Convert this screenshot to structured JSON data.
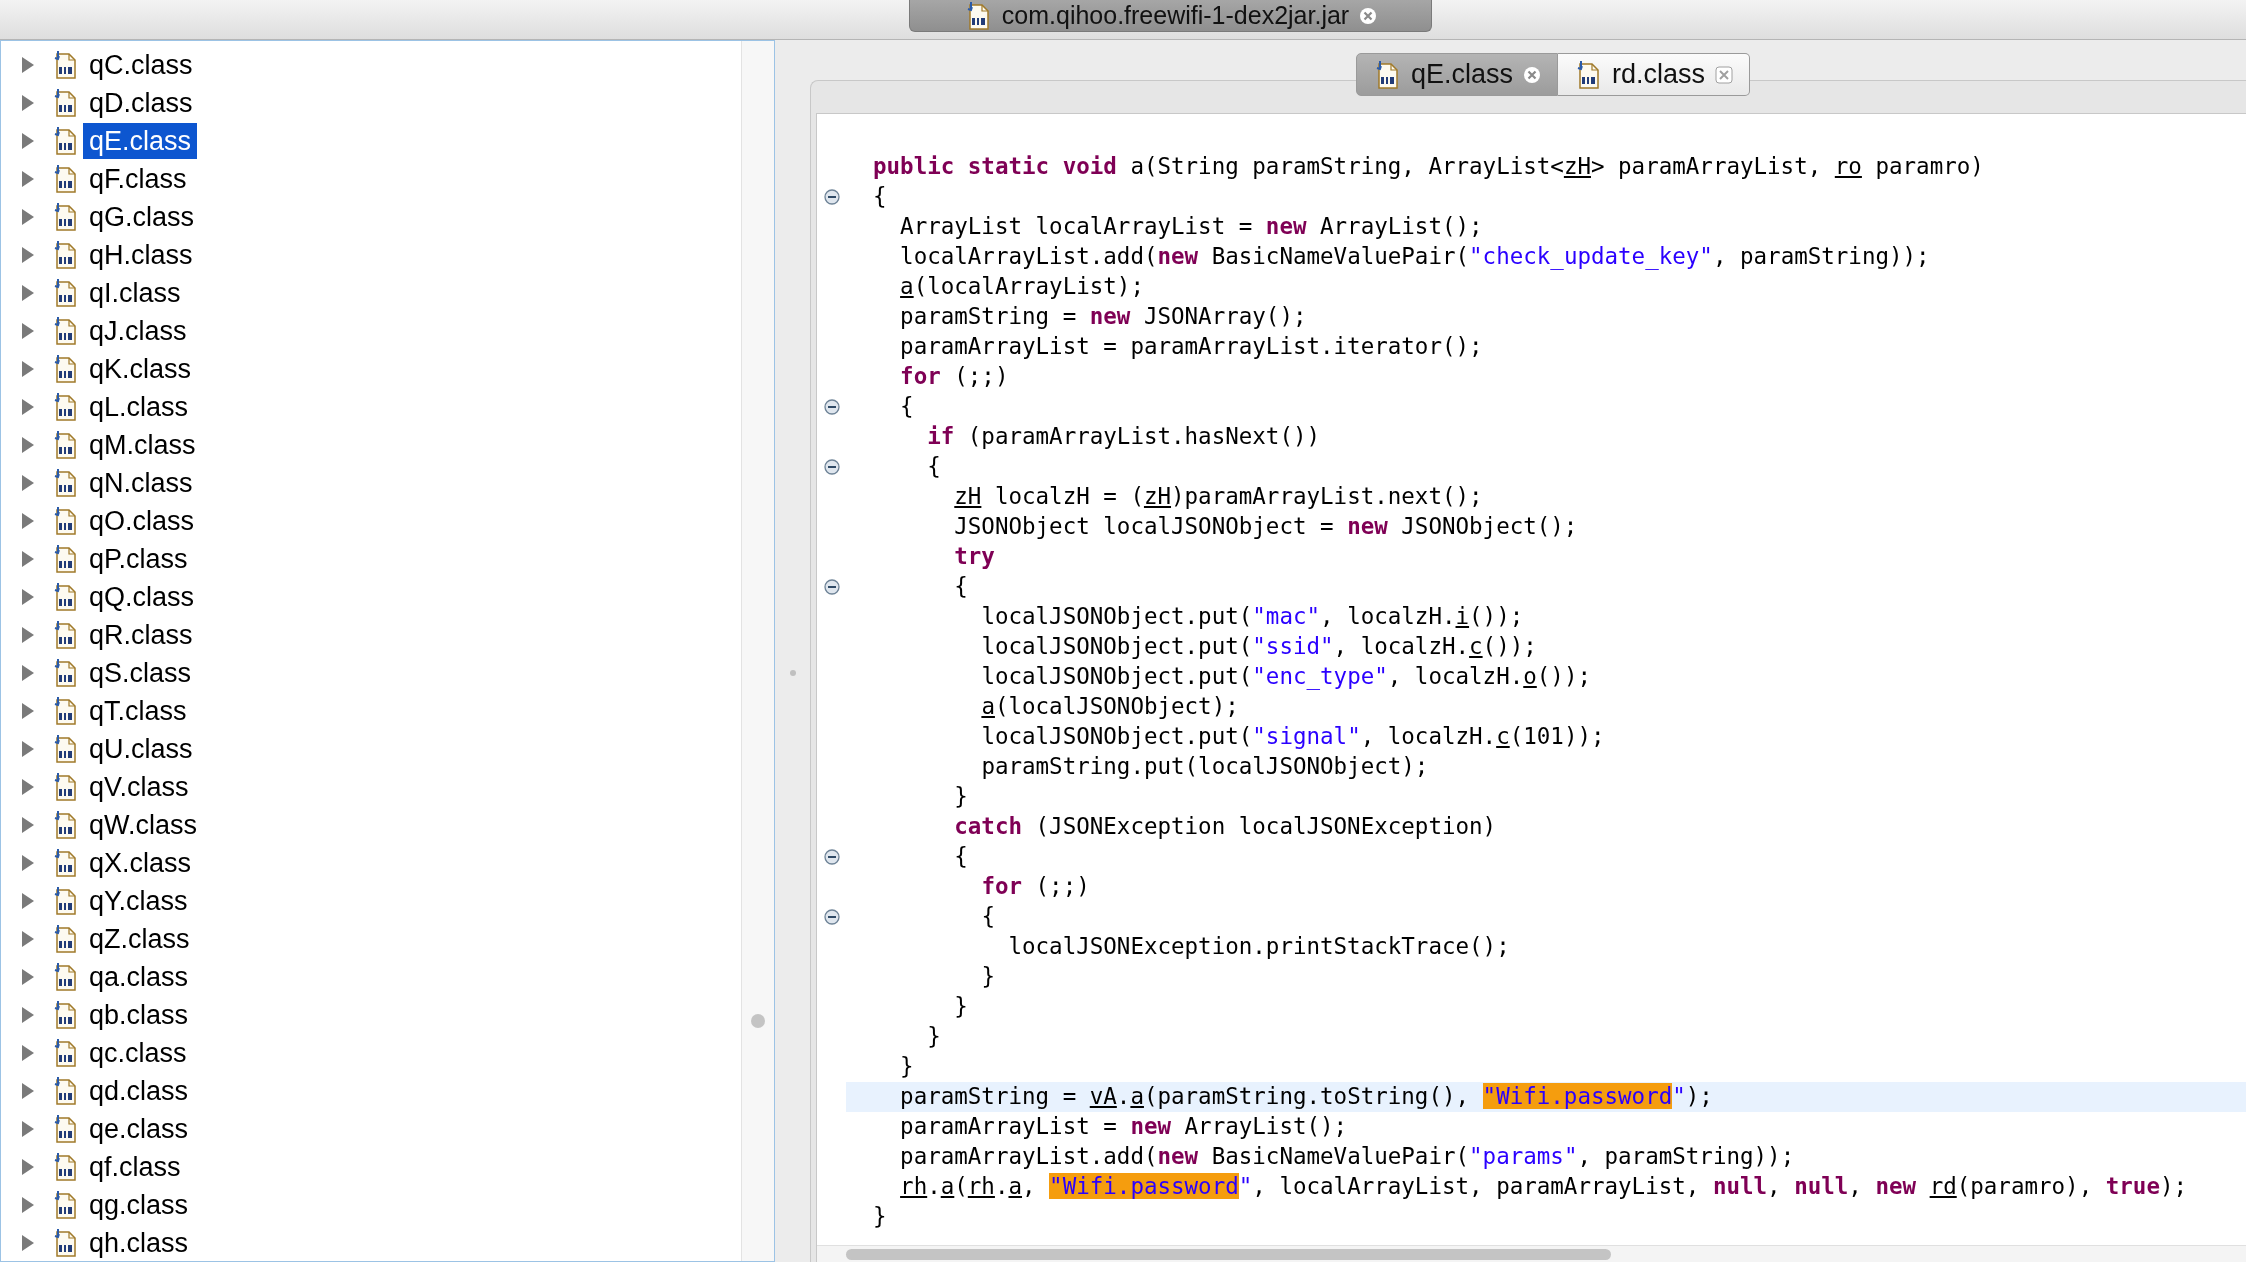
{
  "window_tab": {
    "title": "com.qihoo.freewifi-1-dex2jar.jar"
  },
  "tree": {
    "items": [
      {
        "label": "qC.class",
        "selected": false,
        "expanded": false
      },
      {
        "label": "qD.class",
        "selected": false,
        "expanded": false
      },
      {
        "label": "qE.class",
        "selected": true,
        "expanded": false
      },
      {
        "label": "qF.class",
        "selected": false,
        "expanded": false
      },
      {
        "label": "qG.class",
        "selected": false,
        "expanded": false
      },
      {
        "label": "qH.class",
        "selected": false,
        "expanded": false
      },
      {
        "label": "qI.class",
        "selected": false,
        "expanded": false
      },
      {
        "label": "qJ.class",
        "selected": false,
        "expanded": false
      },
      {
        "label": "qK.class",
        "selected": false,
        "expanded": false
      },
      {
        "label": "qL.class",
        "selected": false,
        "expanded": false
      },
      {
        "label": "qM.class",
        "selected": false,
        "expanded": false
      },
      {
        "label": "qN.class",
        "selected": false,
        "expanded": false
      },
      {
        "label": "qO.class",
        "selected": false,
        "expanded": false
      },
      {
        "label": "qP.class",
        "selected": false,
        "expanded": false
      },
      {
        "label": "qQ.class",
        "selected": false,
        "expanded": false
      },
      {
        "label": "qR.class",
        "selected": false,
        "expanded": false
      },
      {
        "label": "qS.class",
        "selected": false,
        "expanded": false
      },
      {
        "label": "qT.class",
        "selected": false,
        "expanded": false
      },
      {
        "label": "qU.class",
        "selected": false,
        "expanded": false
      },
      {
        "label": "qV.class",
        "selected": false,
        "expanded": false
      },
      {
        "label": "qW.class",
        "selected": false,
        "expanded": false
      },
      {
        "label": "qX.class",
        "selected": false,
        "expanded": false
      },
      {
        "label": "qY.class",
        "selected": false,
        "expanded": false
      },
      {
        "label": "qZ.class",
        "selected": false,
        "expanded": false
      },
      {
        "label": "qa.class",
        "selected": false,
        "expanded": false
      },
      {
        "label": "qb.class",
        "selected": false,
        "expanded": false
      },
      {
        "label": "qc.class",
        "selected": false,
        "expanded": false
      },
      {
        "label": "qd.class",
        "selected": false,
        "expanded": false
      },
      {
        "label": "qe.class",
        "selected": false,
        "expanded": false
      },
      {
        "label": "qf.class",
        "selected": false,
        "expanded": false
      },
      {
        "label": "qg.class",
        "selected": false,
        "expanded": false
      },
      {
        "label": "qh.class",
        "selected": false,
        "expanded": false
      }
    ]
  },
  "tabs": [
    {
      "label": "qE.class",
      "selected": true
    },
    {
      "label": "rd.class",
      "selected": false
    }
  ],
  "code": {
    "lines": [
      {
        "fold": false,
        "current": false,
        "tokens": [
          {
            "kind": "keyword",
            "text": "public static void"
          },
          {
            "kind": "plain",
            "text": " a(String paramString, ArrayList<"
          },
          {
            "kind": "ref",
            "text": "zH"
          },
          {
            "kind": "plain",
            "text": "> paramArrayList, "
          },
          {
            "kind": "ref",
            "text": "ro"
          },
          {
            "kind": "plain",
            "text": " paramro)"
          }
        ]
      },
      {
        "fold": true,
        "current": false,
        "tokens": [
          {
            "kind": "plain",
            "text": "{"
          }
        ]
      },
      {
        "fold": false,
        "current": false,
        "tokens": [
          {
            "kind": "plain",
            "text": "  ArrayList localArrayList = "
          },
          {
            "kind": "keyword",
            "text": "new"
          },
          {
            "kind": "plain",
            "text": " ArrayList();"
          }
        ]
      },
      {
        "fold": false,
        "current": false,
        "tokens": [
          {
            "kind": "plain",
            "text": "  localArrayList.add("
          },
          {
            "kind": "keyword",
            "text": "new"
          },
          {
            "kind": "plain",
            "text": " BasicNameValuePair("
          },
          {
            "kind": "string",
            "text": "\"check_update_key\""
          },
          {
            "kind": "plain",
            "text": ", paramString));"
          }
        ]
      },
      {
        "fold": false,
        "current": false,
        "tokens": [
          {
            "kind": "ref",
            "text": "  a"
          },
          {
            "kind": "plain",
            "text": "(localArrayList);"
          }
        ]
      },
      {
        "fold": false,
        "current": false,
        "tokens": [
          {
            "kind": "plain",
            "text": "  paramString = "
          },
          {
            "kind": "keyword",
            "text": "new"
          },
          {
            "kind": "plain",
            "text": " JSONArray();"
          }
        ]
      },
      {
        "fold": false,
        "current": false,
        "tokens": [
          {
            "kind": "plain",
            "text": "  paramArrayList = paramArrayList.iterator();"
          }
        ]
      },
      {
        "fold": false,
        "current": false,
        "tokens": [
          {
            "kind": "keyword",
            "text": "  for"
          },
          {
            "kind": "plain",
            "text": " (;;)"
          }
        ]
      },
      {
        "fold": true,
        "current": false,
        "tokens": [
          {
            "kind": "plain",
            "text": "  {"
          }
        ]
      },
      {
        "fold": false,
        "current": false,
        "tokens": [
          {
            "kind": "keyword",
            "text": "    if"
          },
          {
            "kind": "plain",
            "text": " (paramArrayList.hasNext())"
          }
        ]
      },
      {
        "fold": true,
        "current": false,
        "tokens": [
          {
            "kind": "plain",
            "text": "    {"
          }
        ]
      },
      {
        "fold": false,
        "current": false,
        "tokens": [
          {
            "kind": "ref",
            "text": "      zH"
          },
          {
            "kind": "plain",
            "text": " localzH = ("
          },
          {
            "kind": "ref",
            "text": "zH"
          },
          {
            "kind": "plain",
            "text": ")paramArrayList.next();"
          }
        ]
      },
      {
        "fold": false,
        "current": false,
        "tokens": [
          {
            "kind": "plain",
            "text": "      JSONObject localJSONObject = "
          },
          {
            "kind": "keyword",
            "text": "new"
          },
          {
            "kind": "plain",
            "text": " JSONObject();"
          }
        ]
      },
      {
        "fold": false,
        "current": false,
        "tokens": [
          {
            "kind": "keyword",
            "text": "      try"
          }
        ]
      },
      {
        "fold": true,
        "current": false,
        "tokens": [
          {
            "kind": "plain",
            "text": "      {"
          }
        ]
      },
      {
        "fold": false,
        "current": false,
        "tokens": [
          {
            "kind": "plain",
            "text": "        localJSONObject.put("
          },
          {
            "kind": "string",
            "text": "\"mac\""
          },
          {
            "kind": "plain",
            "text": ", localzH."
          },
          {
            "kind": "ref",
            "text": "i"
          },
          {
            "kind": "plain",
            "text": "());"
          }
        ]
      },
      {
        "fold": false,
        "current": false,
        "tokens": [
          {
            "kind": "plain",
            "text": "        localJSONObject.put("
          },
          {
            "kind": "string",
            "text": "\"ssid\""
          },
          {
            "kind": "plain",
            "text": ", localzH."
          },
          {
            "kind": "ref",
            "text": "c"
          },
          {
            "kind": "plain",
            "text": "());"
          }
        ]
      },
      {
        "fold": false,
        "current": false,
        "tokens": [
          {
            "kind": "plain",
            "text": "        localJSONObject.put("
          },
          {
            "kind": "string",
            "text": "\"enc_type\""
          },
          {
            "kind": "plain",
            "text": ", localzH."
          },
          {
            "kind": "ref",
            "text": "o"
          },
          {
            "kind": "plain",
            "text": "());"
          }
        ]
      },
      {
        "fold": false,
        "current": false,
        "tokens": [
          {
            "kind": "ref",
            "text": "        a"
          },
          {
            "kind": "plain",
            "text": "(localJSONObject);"
          }
        ]
      },
      {
        "fold": false,
        "current": false,
        "tokens": [
          {
            "kind": "plain",
            "text": "        localJSONObject.put("
          },
          {
            "kind": "string",
            "text": "\"signal\""
          },
          {
            "kind": "plain",
            "text": ", localzH."
          },
          {
            "kind": "ref",
            "text": "c"
          },
          {
            "kind": "plain",
            "text": "(101));"
          }
        ]
      },
      {
        "fold": false,
        "current": false,
        "tokens": [
          {
            "kind": "plain",
            "text": "        paramString.put(localJSONObject);"
          }
        ]
      },
      {
        "fold": false,
        "current": false,
        "tokens": [
          {
            "kind": "plain",
            "text": "      }"
          }
        ]
      },
      {
        "fold": false,
        "current": false,
        "tokens": [
          {
            "kind": "keyword",
            "text": "      catch"
          },
          {
            "kind": "plain",
            "text": " (JSONException localJSONException)"
          }
        ]
      },
      {
        "fold": true,
        "current": false,
        "tokens": [
          {
            "kind": "plain",
            "text": "      {"
          }
        ]
      },
      {
        "fold": false,
        "current": false,
        "tokens": [
          {
            "kind": "keyword",
            "text": "        for"
          },
          {
            "kind": "plain",
            "text": " (;;)"
          }
        ]
      },
      {
        "fold": true,
        "current": false,
        "tokens": [
          {
            "kind": "plain",
            "text": "        {"
          }
        ]
      },
      {
        "fold": false,
        "current": false,
        "tokens": [
          {
            "kind": "plain",
            "text": "          localJSONException.printStackTrace();"
          }
        ]
      },
      {
        "fold": false,
        "current": false,
        "tokens": [
          {
            "kind": "plain",
            "text": "        }"
          }
        ]
      },
      {
        "fold": false,
        "current": false,
        "tokens": [
          {
            "kind": "plain",
            "text": "      }"
          }
        ]
      },
      {
        "fold": false,
        "current": false,
        "tokens": [
          {
            "kind": "plain",
            "text": "    }"
          }
        ]
      },
      {
        "fold": false,
        "current": false,
        "tokens": [
          {
            "kind": "plain",
            "text": "  }"
          }
        ]
      },
      {
        "fold": false,
        "current": true,
        "tokens": [
          {
            "kind": "plain",
            "text": "  paramString = "
          },
          {
            "kind": "ref",
            "text": "vA"
          },
          {
            "kind": "plain",
            "text": "."
          },
          {
            "kind": "ref",
            "text": "a"
          },
          {
            "kind": "plain",
            "text": "(paramString.toString(), "
          },
          {
            "kind": "match",
            "text": "\"Wifi.password"
          },
          {
            "kind": "string",
            "text": "\""
          },
          {
            "kind": "plain",
            "text": ");"
          }
        ]
      },
      {
        "fold": false,
        "current": false,
        "tokens": [
          {
            "kind": "plain",
            "text": "  paramArrayList = "
          },
          {
            "kind": "keyword",
            "text": "new"
          },
          {
            "kind": "plain",
            "text": " ArrayList();"
          }
        ]
      },
      {
        "fold": false,
        "current": false,
        "tokens": [
          {
            "kind": "plain",
            "text": "  paramArrayList.add("
          },
          {
            "kind": "keyword",
            "text": "new"
          },
          {
            "kind": "plain",
            "text": " BasicNameValuePair("
          },
          {
            "kind": "string",
            "text": "\"params\""
          },
          {
            "kind": "plain",
            "text": ", paramString));"
          }
        ]
      },
      {
        "fold": false,
        "current": false,
        "tokens": [
          {
            "kind": "ref",
            "text": "  rh"
          },
          {
            "kind": "plain",
            "text": "."
          },
          {
            "kind": "ref",
            "text": "a"
          },
          {
            "kind": "plain",
            "text": "("
          },
          {
            "kind": "ref",
            "text": "rh"
          },
          {
            "kind": "plain",
            "text": "."
          },
          {
            "kind": "ref",
            "text": "a"
          },
          {
            "kind": "plain",
            "text": ", "
          },
          {
            "kind": "match",
            "text": "\"Wifi.password"
          },
          {
            "kind": "string",
            "text": "\""
          },
          {
            "kind": "plain",
            "text": ", localArrayList, paramArrayList, "
          },
          {
            "kind": "keyword",
            "text": "null"
          },
          {
            "kind": "plain",
            "text": ", "
          },
          {
            "kind": "keyword",
            "text": "null"
          },
          {
            "kind": "plain",
            "text": ", "
          },
          {
            "kind": "keyword",
            "text": "new "
          },
          {
            "kind": "ref",
            "text": "rd"
          },
          {
            "kind": "plain",
            "text": "(paramro), "
          },
          {
            "kind": "keyword",
            "text": "true"
          },
          {
            "kind": "plain",
            "text": ");"
          }
        ]
      },
      {
        "fold": false,
        "current": false,
        "tokens": [
          {
            "kind": "plain",
            "text": "}"
          }
        ]
      }
    ]
  }
}
